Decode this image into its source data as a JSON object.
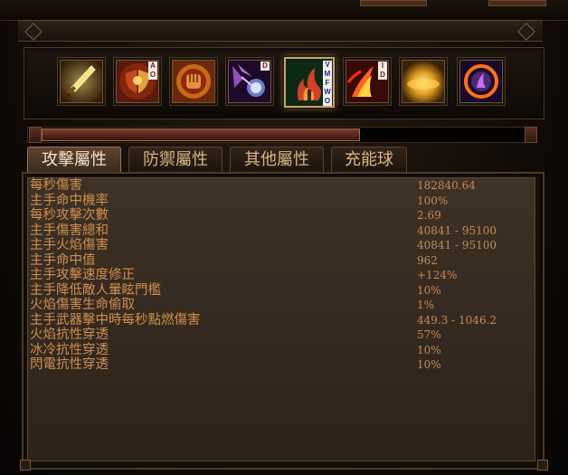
{
  "skills": [
    {
      "name": "sword-skill-icon",
      "badges": []
    },
    {
      "name": "shield-strike-skill-icon",
      "badges": [
        "A",
        "O"
      ]
    },
    {
      "name": "fist-skill-icon",
      "badges": []
    },
    {
      "name": "arcane-orb-skill-icon",
      "badges": [
        "D"
      ]
    },
    {
      "name": "flame-totem-skill-icon",
      "badges": [
        "V",
        "M",
        "F",
        "W",
        "O"
      ],
      "selected": true
    },
    {
      "name": "fire-claw-skill-icon",
      "badges": [
        "I",
        "D"
      ]
    },
    {
      "name": "sun-burst-skill-icon",
      "badges": []
    },
    {
      "name": "fire-ring-skill-icon",
      "badges": []
    }
  ],
  "tabs": [
    {
      "label": "攻擊屬性",
      "active": true
    },
    {
      "label": "防禦屬性",
      "active": false
    },
    {
      "label": "其他屬性",
      "active": false
    },
    {
      "label": "充能球",
      "active": false
    }
  ],
  "scrollbar": {
    "position": 0.62
  },
  "stats": [
    {
      "label": "每秒傷害",
      "value": "182840.64"
    },
    {
      "label": "主手命中機率",
      "value": "100%"
    },
    {
      "label": "每秒攻擊次數",
      "value": "2.69"
    },
    {
      "label": "主手傷害總和",
      "value": "40841 - 95100"
    },
    {
      "label": "主手火焰傷害",
      "value": "40841 - 95100"
    },
    {
      "label": "主手命中值",
      "value": "962"
    },
    {
      "label": "主手攻擊速度修正",
      "value": "+124%"
    },
    {
      "label": "主手降低敵人暈眩門檻",
      "value": "10%"
    },
    {
      "label": "火焰傷害生命偷取",
      "value": "1%"
    },
    {
      "label": "主手武器擊中時每秒點燃傷害",
      "value": "449.3 - 1046.2"
    },
    {
      "label": "火焰抗性穿透",
      "value": "57%"
    },
    {
      "label": "冰冷抗性穿透",
      "value": "10%"
    },
    {
      "label": "閃電抗性穿透",
      "value": "10%"
    }
  ]
}
